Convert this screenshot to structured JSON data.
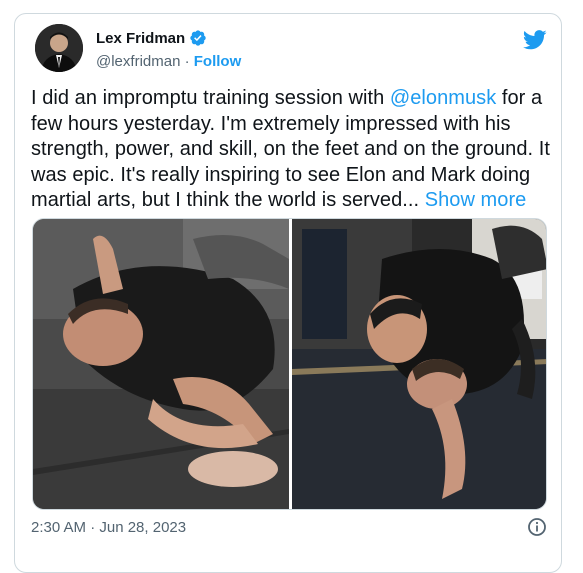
{
  "author": {
    "name": "Lex Fridman",
    "handle": "@lexfridman",
    "separator": " · ",
    "follow_label": "Follow",
    "verified_icon": "verified-badge-icon"
  },
  "tweet": {
    "text_before": "I did an impromptu training session with ",
    "mention": "@elonmusk",
    "text_after": " for a few hours yesterday. I'm extremely impressed with his strength, power, and skill, on the feet and on the ground. It was epic. It's really inspiring to see Elon and Mark doing martial arts, but I think the world is served... ",
    "show_more_label": "Show more"
  },
  "media": {
    "photos": [
      "photo-left",
      "photo-right"
    ]
  },
  "footer": {
    "timestamp": "2:30 AM · Jun 28, 2023",
    "info_icon": "info-icon"
  },
  "colors": {
    "accent": "#1d9bf0",
    "text": "#0f1419",
    "secondary": "#536471",
    "border": "#cfd9de"
  }
}
